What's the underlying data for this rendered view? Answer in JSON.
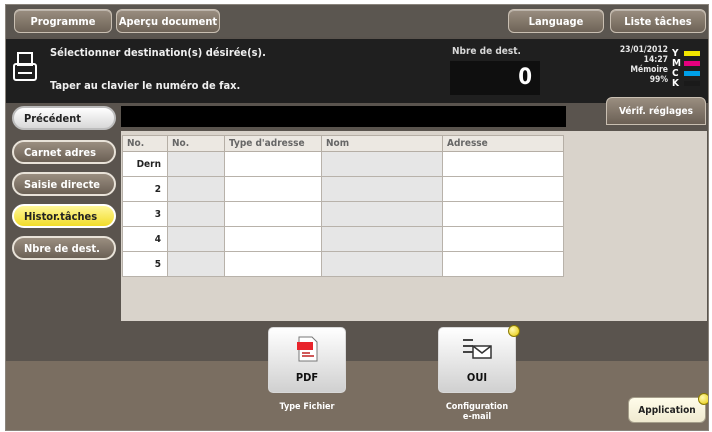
{
  "top_bar": {
    "programme": "Programme",
    "apercu": "Aperçu document",
    "language": "Language",
    "liste_taches": "Liste tâches"
  },
  "message": {
    "line1": "Sélectionner destination(s) désirée(s).",
    "line2": "Taper au clavier le numéro de fax."
  },
  "destinations": {
    "label": "Nbre de dest.",
    "value": "0"
  },
  "status": {
    "date": "23/01/2012",
    "time": "14:27",
    "memory_label": "Mémoire",
    "memory_value": "99%",
    "toner_letters": [
      "Y",
      "M",
      "C",
      "K"
    ],
    "toner_colors": [
      "#f2e600",
      "#e6007e",
      "#00a0e9",
      "#1a1a1a"
    ]
  },
  "sidebar": {
    "precedent": "Précédent",
    "items": [
      {
        "label": "Carnet adres",
        "active": false
      },
      {
        "label": "Saisie directe",
        "active": false
      },
      {
        "label": "Histor.tâches",
        "active": true
      },
      {
        "label": "Nbre de dest.",
        "active": false
      }
    ]
  },
  "verif_button": "Vérif. réglages",
  "table": {
    "headers": [
      "No.",
      "No.",
      "Type d'adresse",
      "Nom",
      "Adresse"
    ],
    "rows": [
      {
        "no": "Dern"
      },
      {
        "no": "2"
      },
      {
        "no": "3"
      },
      {
        "no": "4"
      },
      {
        "no": "5"
      }
    ]
  },
  "bottom": {
    "pdf_button": {
      "label": "PDF",
      "caption": "Type Fichier",
      "icon": "pdf-file-icon"
    },
    "oui_button": {
      "label": "OUI",
      "caption_line1": "Configuration",
      "caption_line2": "e-mail",
      "icon": "email-settings-icon"
    },
    "application": "Application"
  }
}
